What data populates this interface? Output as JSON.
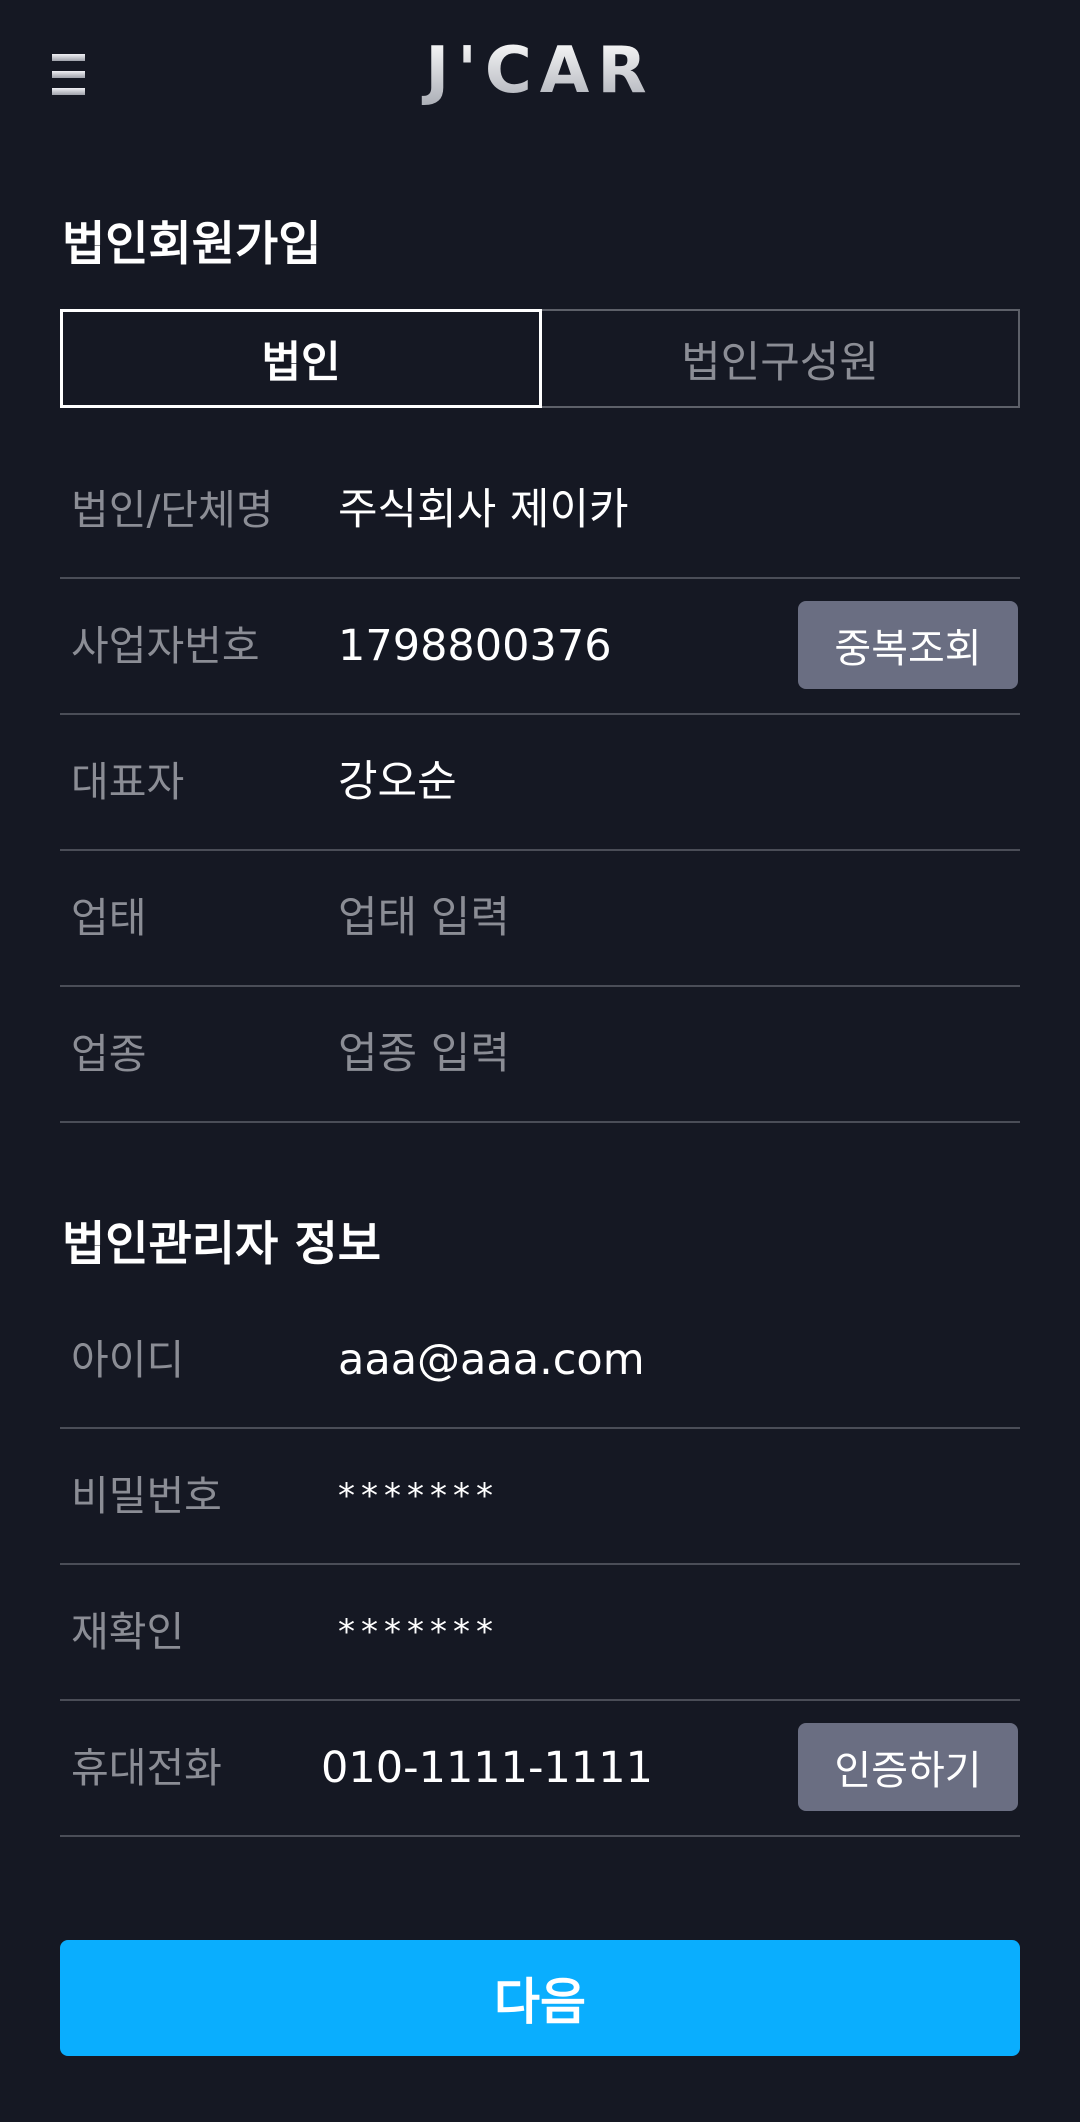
{
  "header": {
    "menu_icon": "hamburger-menu-icon",
    "logo": "J'CAR"
  },
  "page_title": "법인회원가입",
  "tabs": [
    {
      "label": "법인",
      "active": true
    },
    {
      "label": "법인구성원",
      "active": false
    }
  ],
  "company_form": {
    "company_name": {
      "label": "법인/단체명",
      "value": "주식회사 제이카"
    },
    "business_number": {
      "label": "사업자번호",
      "value": "1798800376",
      "button": "중복조회"
    },
    "representative": {
      "label": "대표자",
      "value": "강오순"
    },
    "business_type": {
      "label": "업태",
      "placeholder": "업태 입력",
      "value": ""
    },
    "business_item": {
      "label": "업종",
      "placeholder": "업종 입력",
      "value": ""
    }
  },
  "admin_section_title": "법인관리자 정보",
  "admin_form": {
    "user_id": {
      "label": "아이디",
      "value": "aaa@aaa.com"
    },
    "password": {
      "label": "비밀번호",
      "value": "*******"
    },
    "password_confirm": {
      "label": "재확인",
      "value": "*******"
    },
    "phone": {
      "label": "휴대전화",
      "value": "010-1111-1111",
      "button": "인증하기"
    }
  },
  "next_button": "다음",
  "colors": {
    "background": "#151823",
    "accent": "#0aaefe",
    "secondary_button": "#6a6e82",
    "divider": "#4a4d57",
    "muted_text": "#8b8d95"
  }
}
